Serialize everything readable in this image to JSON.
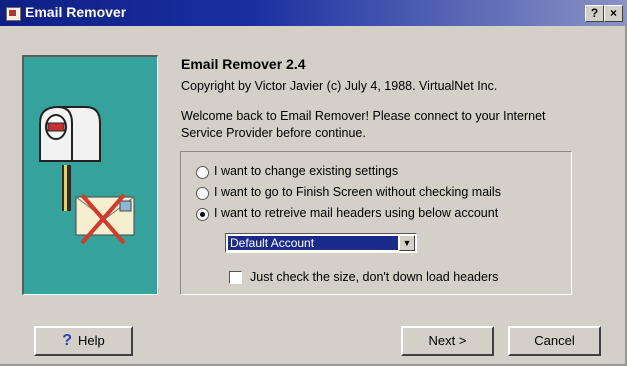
{
  "window": {
    "title": "Email Remover",
    "help_button": "?",
    "close_button": "×"
  },
  "header": {
    "app_name": "Email Remover 2.4",
    "copyright": "Copyright by Victor Javier (c) July 4, 1988. VirtualNet Inc.",
    "welcome": "Welcome back to Email Remover!  Please connect to your Internet Service Provider before continue."
  },
  "options": {
    "radios": [
      {
        "label": "I want to change existing settings",
        "checked": false
      },
      {
        "label": "I want to go to Finish Screen without checking mails",
        "checked": false
      },
      {
        "label": "I want to retreive mail headers using below account",
        "checked": true
      }
    ],
    "account_select": "Default Account",
    "checkbox": {
      "label": "Just check the size, don't down load headers",
      "checked": false
    }
  },
  "buttons": {
    "help": "Help",
    "next": "Next >",
    "cancel": "Cancel"
  },
  "colors": {
    "titlebar": "#0f1f84",
    "illustration_bg": "#35a39b",
    "selection": "#1c2a8a"
  }
}
